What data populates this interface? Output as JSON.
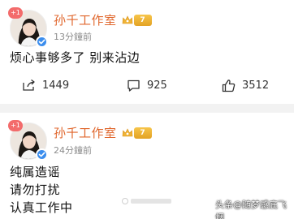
{
  "posts": [
    {
      "username": "孙千工作室",
      "plus_badge": "+1",
      "vip_level": "7",
      "timestamp": "13分鐘前",
      "content_lines": [
        "烦心事够多了 别来沾边"
      ],
      "actions": {
        "repost": "1449",
        "comment": "925",
        "like": "3512"
      }
    },
    {
      "username": "孙千工作室",
      "plus_badge": "+1",
      "vip_level": "7",
      "timestamp": "24分鐘前",
      "content_lines": [
        "纯属造谣",
        "请勿打扰",
        "认真工作中"
      ]
    }
  ],
  "watermarks": {
    "right": "头条@随梦感底飞烟"
  },
  "icons": {
    "repost": "share-icon",
    "comment": "comment-icon",
    "like": "thumbs-up-icon",
    "verified": "verified-icon",
    "vip": "crown-icon"
  },
  "colors": {
    "username": "#e0662c",
    "verified_badge": "#3b8ded",
    "plus_badge": "#f36b6b",
    "vip_badge": "#f0b437",
    "separator": "#f2f2f2"
  }
}
